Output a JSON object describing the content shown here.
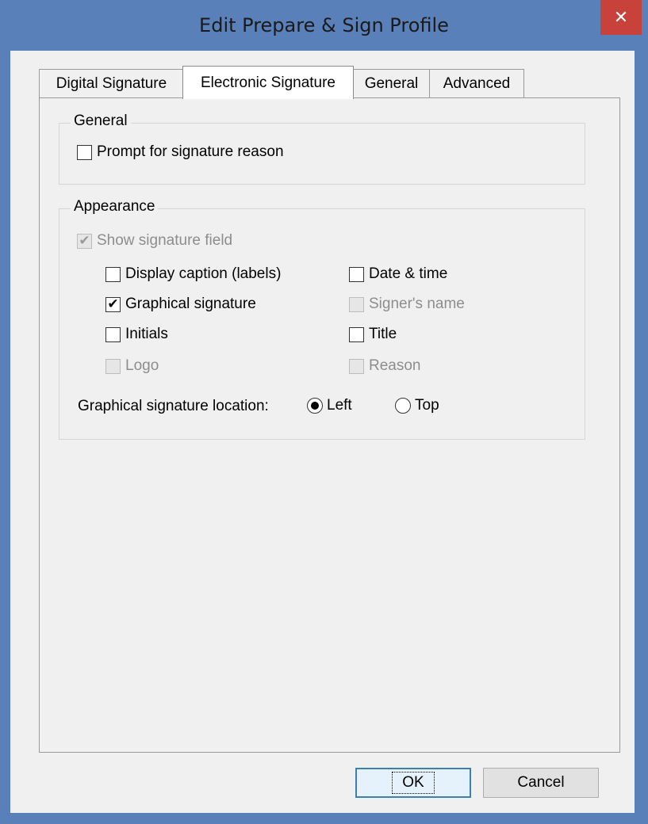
{
  "window": {
    "title": "Edit Prepare & Sign Profile",
    "close_glyph": "✕"
  },
  "tabs": [
    {
      "label": "Digital Signature"
    },
    {
      "label": "Electronic Signature",
      "active": true
    },
    {
      "label": "General"
    },
    {
      "label": "Advanced"
    }
  ],
  "general_group": {
    "title": "General",
    "prompt_reason": {
      "label": "Prompt for signature reason",
      "checked": false
    }
  },
  "appearance_group": {
    "title": "Appearance",
    "show_field": {
      "label": "Show signature field",
      "checked": true,
      "disabled": true
    },
    "options": {
      "display_caption": {
        "label": "Display caption (labels)",
        "checked": false,
        "disabled": false
      },
      "date_time": {
        "label": "Date & time",
        "checked": false,
        "disabled": false
      },
      "graphical_signature": {
        "label": "Graphical signature",
        "checked": true,
        "disabled": false
      },
      "signers_name": {
        "label": "Signer's name",
        "checked": false,
        "disabled": true
      },
      "initials": {
        "label": "Initials",
        "checked": false,
        "disabled": false
      },
      "title": {
        "label": "Title",
        "checked": false,
        "disabled": false
      },
      "logo": {
        "label": "Logo",
        "checked": false,
        "disabled": true
      },
      "reason": {
        "label": "Reason",
        "checked": false,
        "disabled": true
      }
    },
    "location": {
      "label": "Graphical signature location:",
      "left": {
        "label": "Left",
        "selected": true
      },
      "top": {
        "label": "Top",
        "selected": false
      }
    }
  },
  "buttons": {
    "ok": "OK",
    "cancel": "Cancel"
  },
  "icons": {
    "check_glyph": "✔"
  },
  "colors": {
    "titlebar": "#5a80b9",
    "close": "#c8413a",
    "dialog_bg": "#f0f0f0"
  }
}
